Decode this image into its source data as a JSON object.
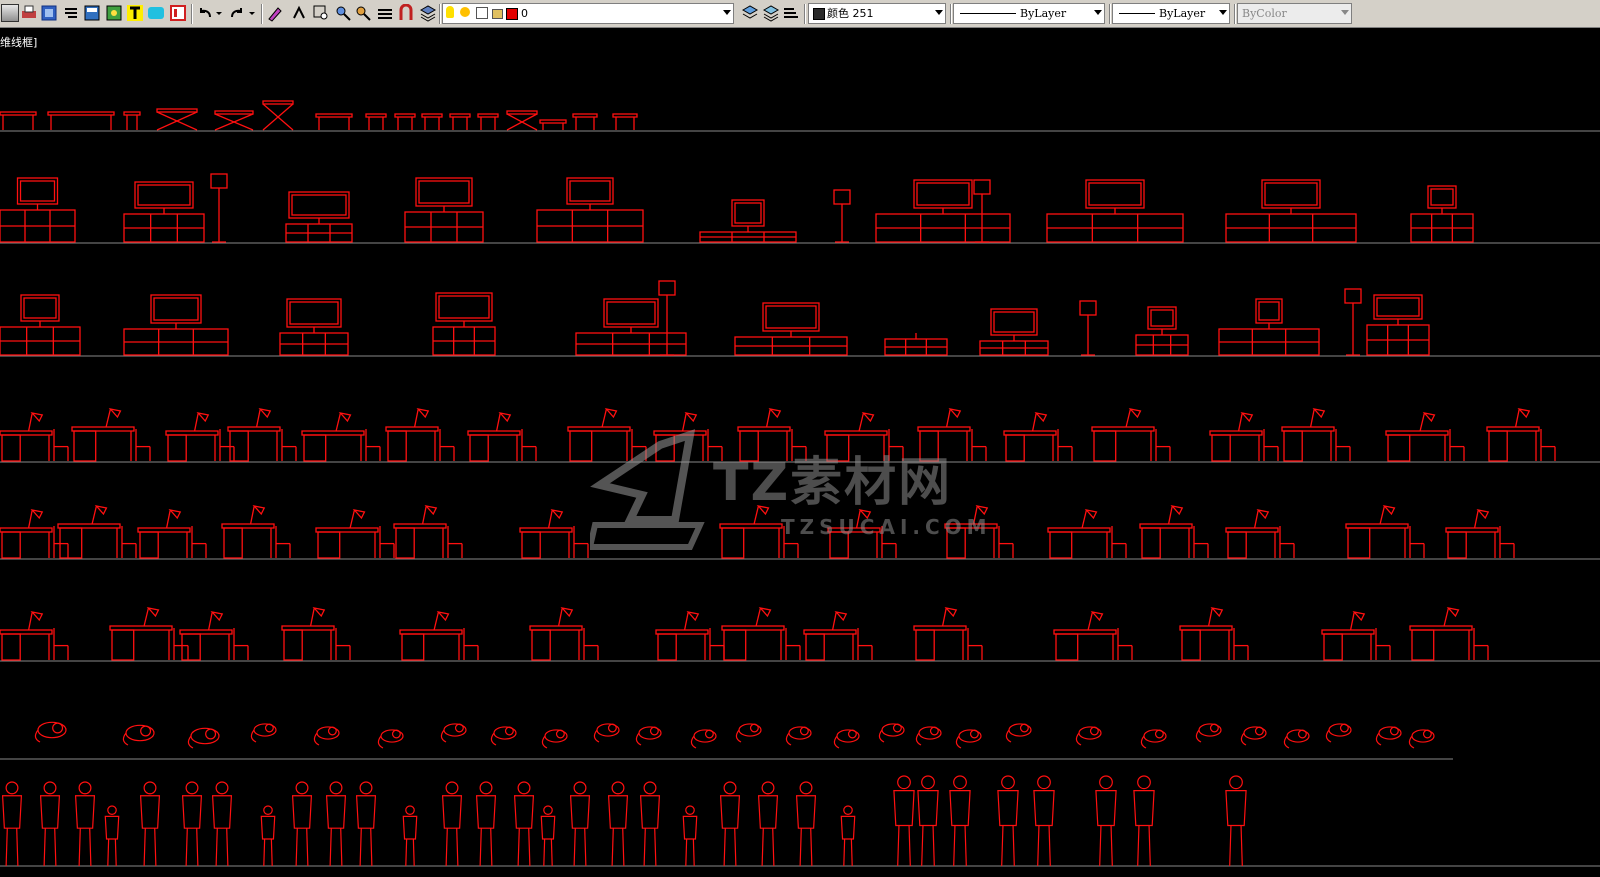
{
  "toolbar": {
    "icons": [
      "open-icon",
      "print-icon",
      "plot-preview-icon",
      "publish-icon",
      "properties-icon",
      "design-center-icon",
      "text-icon",
      "tool-palettes-icon",
      "sheet-set-icon",
      "undo-icon",
      "undo-dropdown-icon",
      "redo-icon",
      "redo-dropdown-icon",
      "match-properties-icon",
      "pan-icon",
      "zoom-window-icon",
      "zoom-realtime-icon",
      "zoom-previous-icon",
      "measure-icon",
      "block-icon",
      "layer-manager-icon"
    ],
    "layer": {
      "name": "0",
      "color": "#e00000",
      "icons": [
        "bulb-on-icon",
        "sun-icon",
        "freeze-icon",
        "lock-icon"
      ]
    },
    "layer_tools": [
      "make-current-icon",
      "layer-previous-icon",
      "layer-states-icon"
    ],
    "color_combo": {
      "label": "颜色 251"
    },
    "linetype_combo": {
      "label": "ByLayer"
    },
    "lineweight_combo": {
      "label": "ByLayer"
    },
    "plotstyle_combo": {
      "label": "ByColor"
    }
  },
  "viewport": {
    "label": "维线框]"
  },
  "watermark": {
    "title": "TZ素材网",
    "url": "TZSUCAI.COM"
  },
  "drawing": {
    "line_color": "#ff1010",
    "separator_color": "#888888",
    "background": "#000000"
  }
}
